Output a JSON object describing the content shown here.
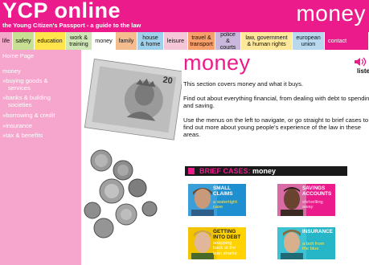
{
  "header": {
    "logo": "YCP online",
    "tagline": "the Young Citizen's Passport - a guide to the law",
    "section": "money"
  },
  "nav": {
    "tabs": [
      {
        "label": "life",
        "color": "#f3a9c9"
      },
      {
        "label": "safety",
        "color": "#c6df92"
      },
      {
        "label": "education",
        "color": "#ffe44c"
      },
      {
        "label": "work & training",
        "color": "#cfe6b6"
      },
      {
        "label": "money",
        "color": "#ffffff"
      },
      {
        "label": "family",
        "color": "#f5bc8e"
      },
      {
        "label": "house & home",
        "color": "#9ed2ec"
      },
      {
        "label": "leisure",
        "color": "#f4c6d8"
      },
      {
        "label": "travel & transport",
        "color": "#f7a06c"
      },
      {
        "label": "police & courts",
        "color": "#c9b7dc"
      },
      {
        "label": "law, government & human rights",
        "color": "#ffe89a"
      },
      {
        "label": "european union",
        "color": "#b9d7ed"
      },
      {
        "label": "contact",
        "color": "#ec1b8c"
      }
    ]
  },
  "sidebar": {
    "home": "Home Page",
    "heading": "money",
    "items": [
      {
        "label": "»buying goods &"
      },
      {
        "label": "  services"
      },
      {
        "label": "»banks & building"
      },
      {
        "label": "  societies"
      },
      {
        "label": "»borrowing & credit"
      },
      {
        "label": "»insurance"
      },
      {
        "label": "»tax & benefits"
      }
    ]
  },
  "main": {
    "title": "money",
    "intro": "This section covers money and what it buys.",
    "para2_line1": "Find out about everything financial, from dealing with debt to spending",
    "para2_line2": "and saving.",
    "para3_line1": "Use the menus on the left to navigate, or go straight to brief cases to",
    "para3_line2": "find out more about young people's experience of the law in these",
    "para3_line3": "areas.",
    "listen": "listen"
  },
  "brief_cases": {
    "title": "BRIEF CASES:",
    "subtitle": "money",
    "cards": [
      {
        "title_1": "SMALL",
        "title_2": "CLAIMS",
        "sub_1": "a watertight",
        "sub_2": "case",
        "color": "#1e8fd0"
      },
      {
        "title_1": "SAVINGS",
        "title_2": "ACCOUNTS",
        "sub_1": "shrivelling",
        "sub_2": "away",
        "color": "#ec1b8c"
      },
      {
        "title_1": "GETTING",
        "title_2": "INTO DEBT",
        "sub_1": "snapping",
        "sub_2": "back at the",
        "sub_3": "loan sharks",
        "color": "#ffd200"
      },
      {
        "title_1": "INSURANCE",
        "sub_1": "a bolt from",
        "sub_2": "the blue",
        "color": "#27b6c8"
      }
    ]
  },
  "colors": {
    "brand": "#ec1b8c",
    "sidebar": "#f6a6cc"
  }
}
